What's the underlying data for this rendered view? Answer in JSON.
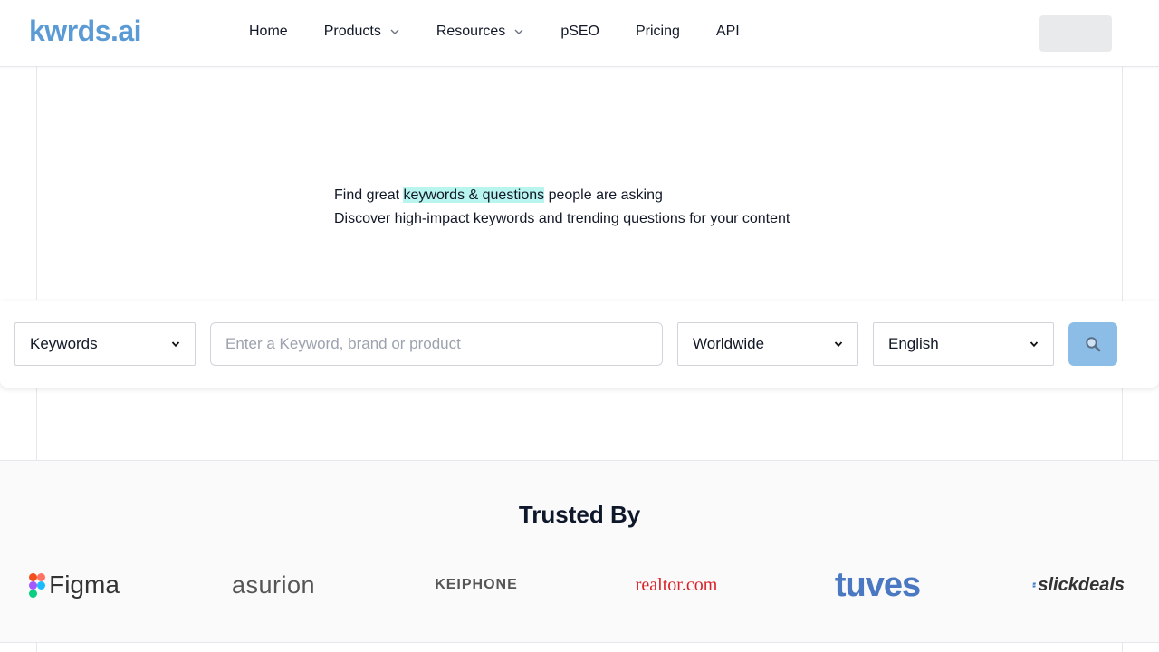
{
  "header": {
    "logo": "kwrds.ai",
    "nav": [
      {
        "label": "Home"
      },
      {
        "label": "Products"
      },
      {
        "label": "Resources"
      },
      {
        "label": "pSEO"
      },
      {
        "label": "Pricing"
      },
      {
        "label": "API"
      }
    ]
  },
  "hero": {
    "line1_pre": "Find great ",
    "line1_highlight": "keywords & questions",
    "line1_post": " people are asking",
    "line2": "Discover high-impact keywords and trending questions for your content"
  },
  "search": {
    "type_value": "Keywords",
    "placeholder": "Enter a Keyword, brand or product",
    "location_value": "Worldwide",
    "language_value": "English",
    "button_icon": "🔍"
  },
  "trusted": {
    "title": "Trusted By",
    "brands": [
      "Figma",
      "asurion",
      "KEIPHONE",
      "realtor.com",
      "tuves",
      "slickdeals"
    ]
  },
  "colors": {
    "logo": "#5b9bd5",
    "highlight": "#b8f5ef",
    "search_button": "#8bbde6"
  }
}
